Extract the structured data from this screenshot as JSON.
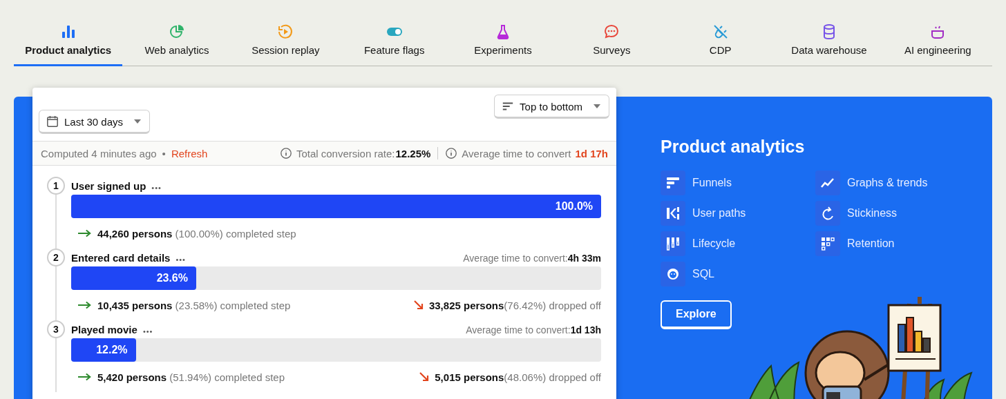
{
  "tabs": [
    {
      "label": "Product analytics",
      "selected": true,
      "color": "#1d6ef5"
    },
    {
      "label": "Web analytics",
      "selected": false,
      "color": "#2fb36a"
    },
    {
      "label": "Session replay",
      "selected": false,
      "color": "#f29a1a"
    },
    {
      "label": "Feature flags",
      "selected": false,
      "color": "#29a7bf"
    },
    {
      "label": "Experiments",
      "selected": false,
      "color": "#b62ad9"
    },
    {
      "label": "Surveys",
      "selected": false,
      "color": "#e8473b"
    },
    {
      "label": "CDP",
      "selected": false,
      "color": "#2a9bd6"
    },
    {
      "label": "Data warehouse",
      "selected": false,
      "color": "#7653e8"
    },
    {
      "label": "AI engineering",
      "selected": false,
      "color": "#a12cc4"
    }
  ],
  "funnel": {
    "date_range": "Last 30 days",
    "order": "Top to bottom",
    "computed": "Computed 4 minutes ago",
    "separator": "•",
    "refresh": "Refresh",
    "conversion_label": "Total conversion rate:",
    "conversion_value": "12.25%",
    "avg_label": "Average time to convert",
    "avg_value": "1d 17h",
    "steps": [
      {
        "number": "1",
        "name": "User signed up",
        "more": "•••",
        "level": 1.0,
        "percent": "100.0%",
        "persons": "44,260 persons",
        "share": "(100.00%) completed step"
      },
      {
        "number": "2",
        "name": "Entered card details",
        "more": "•••",
        "avg_time_label": "Average time to convert:",
        "avg_time": "4h 33m",
        "level": 0.236,
        "percent": "23.6%",
        "persons": "10,435 persons",
        "share": "(23.58%) completed step",
        "dropped_persons": "33,825 persons",
        "dropped_share": "(76.42%) dropped off"
      },
      {
        "number": "3",
        "name": "Played movie",
        "more": "•••",
        "avg_time_label": "Average time to convert:",
        "avg_time": "1d 13h",
        "level": 0.122,
        "percent": "12.2%",
        "persons": "5,420 persons",
        "share": "(51.94%) completed step",
        "dropped_persons": "5,015 persons",
        "dropped_share": "(48.06%) dropped off"
      }
    ]
  },
  "product": {
    "title": "Product analytics",
    "features": [
      {
        "label": "Funnels"
      },
      {
        "label": "Graphs & trends"
      },
      {
        "label": "User paths"
      },
      {
        "label": "Stickiness"
      },
      {
        "label": "Lifecycle"
      },
      {
        "label": "Retention"
      },
      {
        "label": "SQL"
      }
    ],
    "button": "Explore"
  }
}
